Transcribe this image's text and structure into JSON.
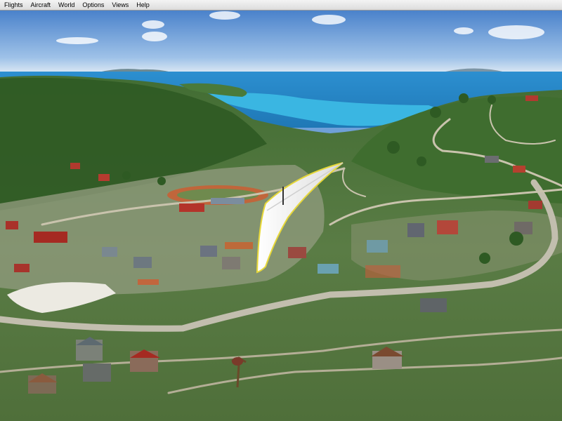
{
  "menu": {
    "items": [
      {
        "label": "Flights"
      },
      {
        "label": "Aircraft"
      },
      {
        "label": "World"
      },
      {
        "label": "Options"
      },
      {
        "label": "Views"
      },
      {
        "label": "Help"
      }
    ]
  },
  "colors": {
    "sky_top": "#4f86cc",
    "sky_bottom": "#dfe9f4",
    "sea": "#2fa0d6",
    "hill_green": "#3d6a2c",
    "ground_green": "#567a3a",
    "road": "#b9b6a8",
    "roof_red": "#b8322a",
    "glider_sail": "#f3f3f3",
    "glider_edge": "#e4d23a"
  },
  "icons": {
    "aircraft": "hang-glider-icon"
  }
}
